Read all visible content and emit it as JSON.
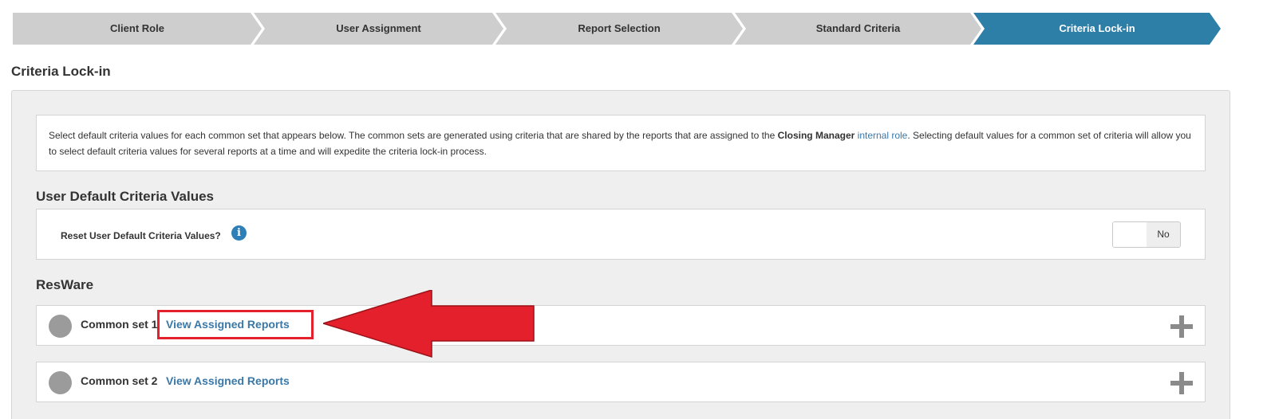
{
  "wizard": {
    "steps": [
      {
        "label": "Client Role",
        "active": false
      },
      {
        "label": "User Assignment",
        "active": false
      },
      {
        "label": "Report Selection",
        "active": false
      },
      {
        "label": "Standard Criteria",
        "active": false
      },
      {
        "label": "Criteria Lock-in",
        "active": true
      }
    ],
    "inactive_color": "#cecece",
    "active_color": "#2e7fa8"
  },
  "page_title": "Criteria Lock-in",
  "info": {
    "text_before": "Select default criteria values for each common set that appears below. The common sets are generated using criteria that are shared by the reports that are assigned to the ",
    "role_name": "Closing Manager",
    "role_link": "internal role",
    "text_after": ". Selecting default values for a common set of criteria will allow you to select default criteria values for several reports at a time and will expedite the criteria lock-in process."
  },
  "user_defaults": {
    "title": "User Default Criteria Values",
    "reset_label": "Reset User Default Criteria Values?",
    "info_icon": "info-icon",
    "toggle_value": "No"
  },
  "resware": {
    "title": "ResWare",
    "sets": [
      {
        "label": "Common set 1",
        "link": "View Assigned Reports"
      },
      {
        "label": "Common set 2",
        "link": "View Assigned Reports"
      }
    ]
  },
  "annotation": {
    "color": "#e3202b"
  }
}
